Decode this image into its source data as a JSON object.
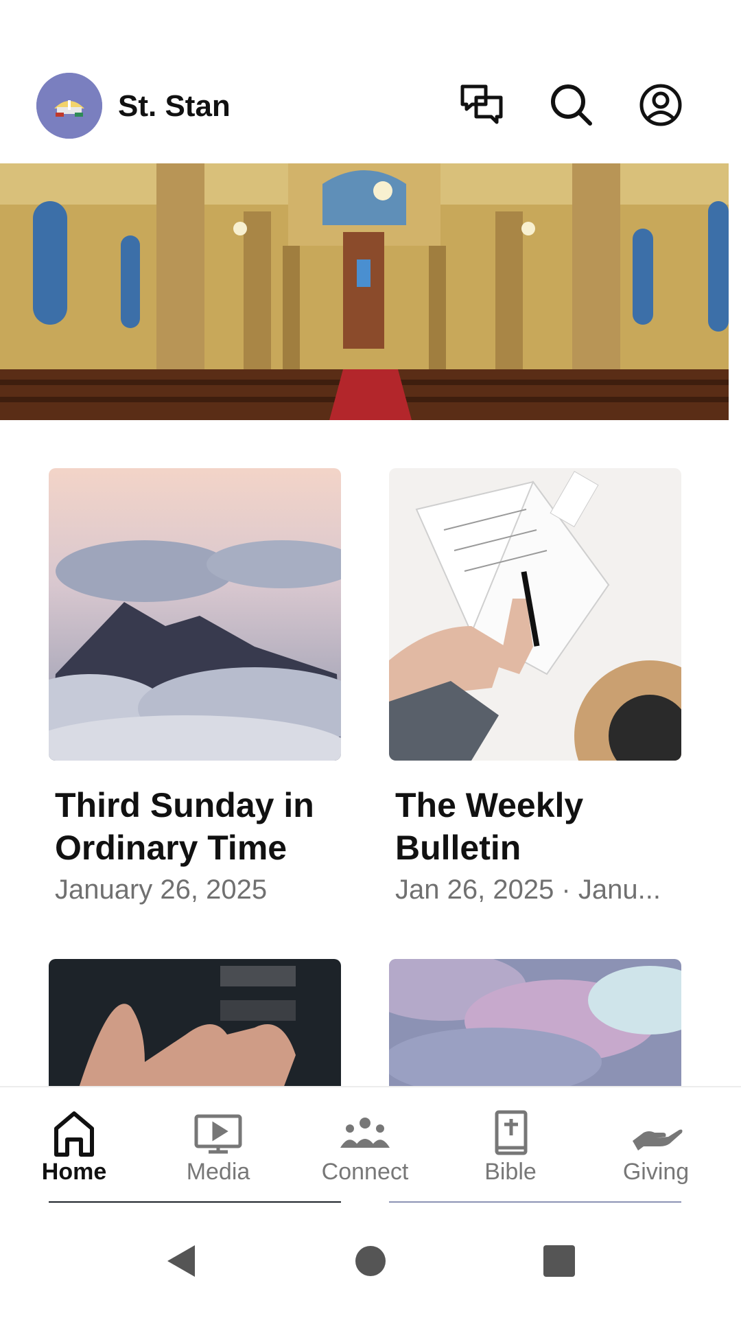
{
  "header": {
    "title": "St. Stan",
    "icons": [
      "avatar-logo",
      "chat-icon",
      "search-icon",
      "account-icon"
    ]
  },
  "hero": {
    "image": "church-interior"
  },
  "cards": [
    {
      "title": "Third Sunday in Ordinary Time",
      "date": "January 26, 2025",
      "image": "mountains-clouds"
    },
    {
      "title": "The Weekly Bulletin",
      "date": "Jan 26, 2025 · Janu...",
      "image": "planner-hands-hat"
    },
    {
      "title": "",
      "date": "",
      "image": "open-hands"
    },
    {
      "title": "",
      "date": "",
      "image": "pink-clouds"
    }
  ],
  "bottom_nav": {
    "items": [
      {
        "label": "Home",
        "icon": "home-icon",
        "active": true
      },
      {
        "label": "Media",
        "icon": "media-icon",
        "active": false
      },
      {
        "label": "Connect",
        "icon": "connect-icon",
        "active": false
      },
      {
        "label": "Bible",
        "icon": "bible-icon",
        "active": false
      },
      {
        "label": "Giving",
        "icon": "giving-icon",
        "active": false
      }
    ]
  },
  "system_nav": [
    "back-icon",
    "home-circle-icon",
    "recents-icon"
  ],
  "colors": {
    "accent": "#111111",
    "inactive": "#777777",
    "avatar_bg": "#7a7fbf"
  }
}
